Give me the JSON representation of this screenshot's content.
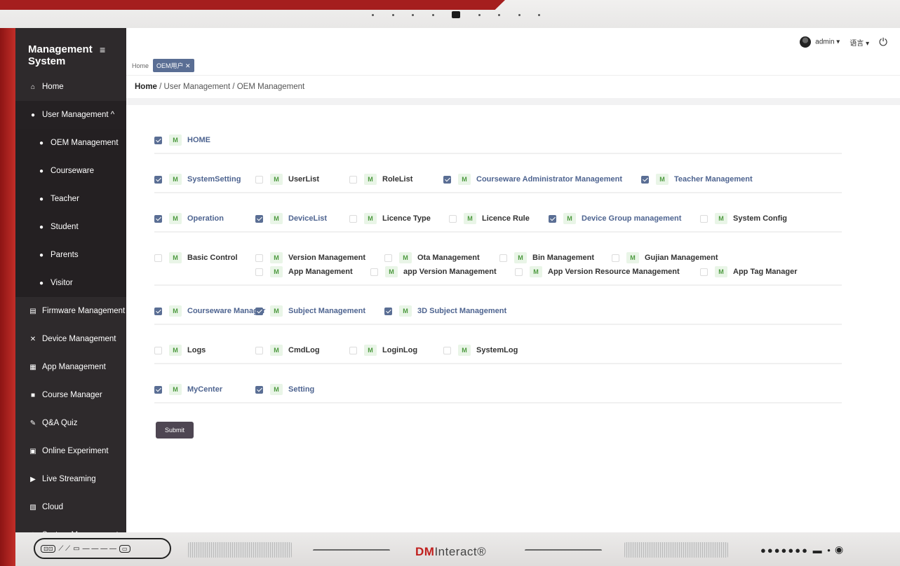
{
  "app": {
    "title": "Management System"
  },
  "topbar": {
    "user": "admin ▾",
    "lang": "语言 ▾"
  },
  "tags": {
    "home": "Home",
    "active": "OEM用户 ✕"
  },
  "breadcrumb": {
    "home": "Home",
    "rest": " / User Management / OEM Management"
  },
  "sidebar": {
    "items": [
      {
        "label": "Home",
        "icon": "home-icon",
        "glyph": "⌂"
      },
      {
        "label": "User Management ^",
        "icon": "user-icon",
        "glyph": "●"
      },
      {
        "label": "OEM Management",
        "icon": "user-icon",
        "glyph": "●"
      },
      {
        "label": "Courseware",
        "icon": "user-icon",
        "glyph": "●"
      },
      {
        "label": "Teacher",
        "icon": "user-icon",
        "glyph": "●"
      },
      {
        "label": "Student",
        "icon": "user-icon",
        "glyph": "●"
      },
      {
        "label": "Parents",
        "icon": "user-icon",
        "glyph": "●"
      },
      {
        "label": "Visitor",
        "icon": "user-icon",
        "glyph": "●"
      },
      {
        "label": "Firmware Management",
        "icon": "firmware-icon",
        "glyph": "▤"
      },
      {
        "label": "Device Management",
        "icon": "tools-icon",
        "glyph": "✕"
      },
      {
        "label": "App Management",
        "icon": "apps-icon",
        "glyph": "▦"
      },
      {
        "label": "Course Manager",
        "icon": "book-icon",
        "glyph": "■"
      },
      {
        "label": "Q&A Quiz",
        "icon": "pen-icon",
        "glyph": "✎"
      },
      {
        "label": "Online Experiment",
        "icon": "monitor-icon",
        "glyph": "▣"
      },
      {
        "label": "Live Streaming",
        "icon": "video-icon",
        "glyph": "▶"
      },
      {
        "label": "Cloud",
        "icon": "image-icon",
        "glyph": "▧"
      },
      {
        "label": "System Management",
        "icon": "gear-icon",
        "glyph": "⚙"
      }
    ]
  },
  "permissions": {
    "m_badge": "M",
    "rows": [
      {
        "items": [
          {
            "label": "HOME",
            "checked": true
          }
        ]
      },
      {
        "items": [
          {
            "label": "SystemSetting",
            "checked": true
          },
          {
            "label": "UserList",
            "checked": false
          },
          {
            "label": "RoleList",
            "checked": false
          },
          {
            "label": "Courseware Administrator Management",
            "checked": true
          },
          {
            "label": "Teacher Management",
            "checked": true
          }
        ]
      },
      {
        "items": [
          {
            "label": "Operation",
            "checked": true
          },
          {
            "label": "DeviceList",
            "checked": true
          },
          {
            "label": "Licence Type",
            "checked": false
          },
          {
            "label": "Licence Rule",
            "checked": false
          },
          {
            "label": "Device Group management",
            "checked": true
          },
          {
            "label": "System Config",
            "checked": false
          }
        ]
      },
      {
        "items": [
          {
            "label": "Basic Control",
            "checked": false
          },
          {
            "label": "Version Management",
            "checked": false
          },
          {
            "label": "Ota Management",
            "checked": false
          },
          {
            "label": "Bin Management",
            "checked": false
          },
          {
            "label": "Gujian Management",
            "checked": false
          },
          {
            "label": "App Management",
            "checked": false
          },
          {
            "label": "app Version Management",
            "checked": false
          },
          {
            "label": "App Version Resource Management",
            "checked": false
          },
          {
            "label": "App Tag Manager",
            "checked": false
          }
        ]
      },
      {
        "items": [
          {
            "label": "Courseware Manager",
            "checked": true
          },
          {
            "label": "Subject Management",
            "checked": true
          },
          {
            "label": "3D Subject Management",
            "checked": true
          }
        ]
      },
      {
        "items": [
          {
            "label": "Logs",
            "checked": false
          },
          {
            "label": "CmdLog",
            "checked": false
          },
          {
            "label": "LoginLog",
            "checked": false
          },
          {
            "label": "SystemLog",
            "checked": false
          }
        ]
      },
      {
        "items": [
          {
            "label": "MyCenter",
            "checked": true
          },
          {
            "label": "Setting",
            "checked": true
          }
        ]
      }
    ]
  },
  "submit_label": "Submit",
  "bezel": {
    "brand_dm": "DM",
    "brand_rest": "Interact®"
  },
  "colors": {
    "accent": "#5a6e94",
    "sidebar": "#2e2a2c",
    "bezel_red": "#c7302a"
  }
}
